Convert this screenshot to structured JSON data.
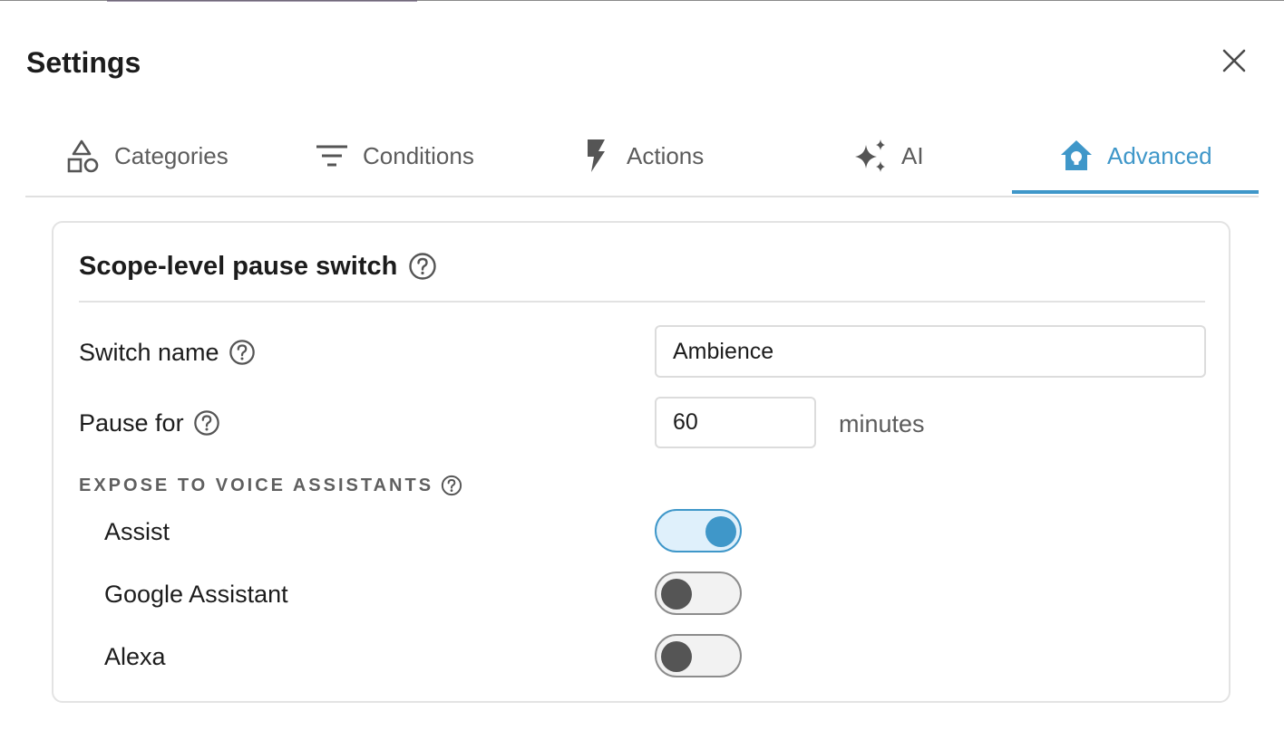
{
  "dialog": {
    "title": "Settings",
    "close_icon": "close-icon"
  },
  "tabs": [
    {
      "label": "Categories",
      "icon": "shapes-icon",
      "active": false
    },
    {
      "label": "Conditions",
      "icon": "filter-icon",
      "active": false
    },
    {
      "label": "Actions",
      "icon": "flash-icon",
      "active": false
    },
    {
      "label": "AI",
      "icon": "sparkles-icon",
      "active": false
    },
    {
      "label": "Advanced",
      "icon": "home-lightbulb-icon",
      "active": true
    }
  ],
  "card": {
    "title": "Scope-level pause switch",
    "switch_name": {
      "label": "Switch name",
      "value": "Ambience"
    },
    "pause_for": {
      "label": "Pause for",
      "value": "60",
      "unit": "minutes"
    },
    "voice_section": {
      "header": "EXPOSE TO VOICE ASSISTANTS",
      "assistants": [
        {
          "label": "Assist",
          "enabled": true
        },
        {
          "label": "Google Assistant",
          "enabled": false
        },
        {
          "label": "Alexa",
          "enabled": false
        }
      ]
    }
  },
  "colors": {
    "accent": "#3f97c9",
    "text": "#1c1c1c",
    "muted": "#5c5c5c"
  }
}
